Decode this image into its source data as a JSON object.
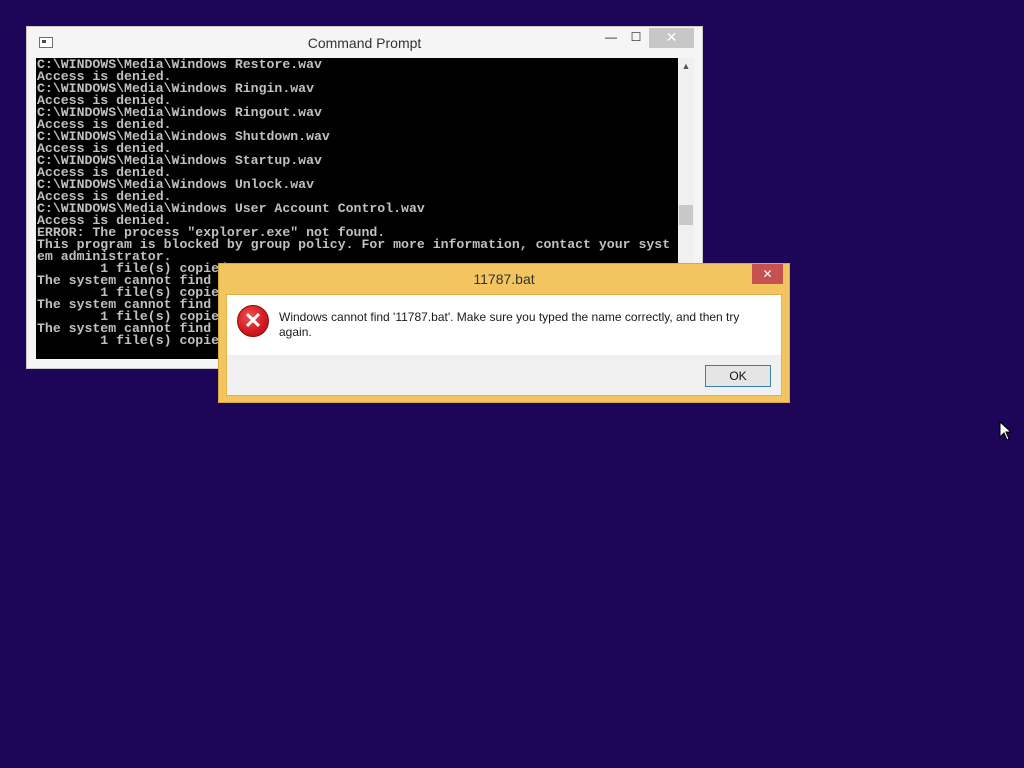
{
  "cmd_window": {
    "title": "Command Prompt",
    "controls": {
      "minimize": "—",
      "maximize": "☐",
      "close": "✕"
    },
    "console_lines": [
      "C:\\WINDOWS\\Media\\Windows Restore.wav",
      "Access is denied.",
      "C:\\WINDOWS\\Media\\Windows Ringin.wav",
      "Access is denied.",
      "C:\\WINDOWS\\Media\\Windows Ringout.wav",
      "Access is denied.",
      "C:\\WINDOWS\\Media\\Windows Shutdown.wav",
      "Access is denied.",
      "C:\\WINDOWS\\Media\\Windows Startup.wav",
      "Access is denied.",
      "C:\\WINDOWS\\Media\\Windows Unlock.wav",
      "Access is denied.",
      "C:\\WINDOWS\\Media\\Windows User Account Control.wav",
      "Access is denied.",
      "ERROR: The process \"explorer.exe\" not found.",
      "This program is blocked by group policy. For more information, contact your syst",
      "em administrator.",
      "        1 file(s) copied.",
      "The system cannot find",
      "        1 file(s) copied.",
      "The system cannot find",
      "        1 file(s) copied.",
      "The system cannot find",
      "        1 file(s) copied."
    ],
    "scroll_up_icon": "triangle-up"
  },
  "dialog": {
    "title": "11787.bat",
    "close_label": "✕",
    "message": "Windows cannot find '11787.bat'. Make sure you typed the name correctly, and then try again.",
    "ok_label": "OK",
    "icon": "error-icon",
    "icon_glyph": "✕"
  },
  "colors": {
    "desktop": "#1d0657",
    "dialog_frame": "#f2c560",
    "dialog_close": "#c75050"
  }
}
